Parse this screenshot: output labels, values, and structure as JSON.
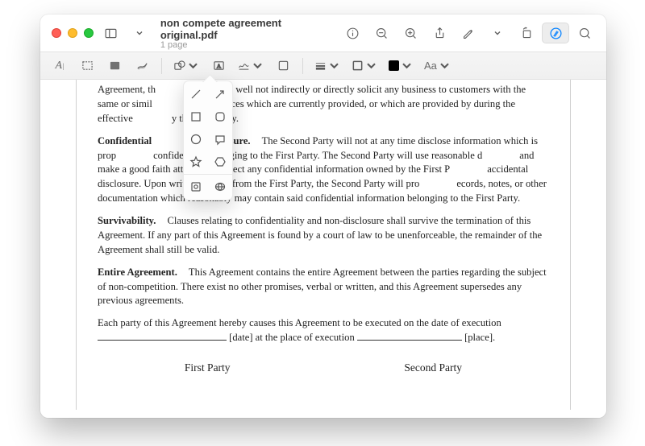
{
  "window": {
    "title": "non compete agreement original.pdf",
    "subtitle": "1 page"
  },
  "markup_toolbar": {
    "font_label": "Aa"
  },
  "document": {
    "p1_fragment_a": "Agreement, th",
    "p1_fragment_b": "d Party well not indirectly or directly solicit any business to customers with the same or simil",
    "p1_fragment_c": "ts or services which are currently provided, or which are provided by during the effective",
    "p1_fragment_d": "y the First Party.",
    "p2_head": "Confidential",
    "p2_head2": "on-Disclosure.",
    "p2_a": "The Second Party will not at any time disclose information which is prop",
    "p2_b": "confidential, belonging to the First Party. The Second Party will use reasonable d",
    "p2_c": "and make a good faith attempt to protect any confidential information owned by the First P",
    "p2_d": "accidental disclosure. Upon written request from the First Party, the Second Party will pro",
    "p2_e": "ecords, notes, or other documentation which reasonably may contain said confidential information belonging to the First Party.",
    "p3_head": "Survivability.",
    "p3_body": "Clauses relating to confidentiality and non-disclosure shall survive the termination of this Agreement. If any part of this Agreement is found by a court of law to be unenforceable, the remainder of the Agreement shall still be valid.",
    "p4_head": "Entire Agreement.",
    "p4_body": "This Agreement contains the entire Agreement between the parties regarding the subject of non-competition. There exist no other promises, verbal or written, and this Agreement supersedes any previous agreements.",
    "p5_a": "Each party of this Agreement hereby causes this Agreement to be executed on the date of execution",
    "p5_b": "[date] at the place of execution",
    "p5_c": "[place].",
    "sig1": "First Party",
    "sig2": "Second Party"
  }
}
